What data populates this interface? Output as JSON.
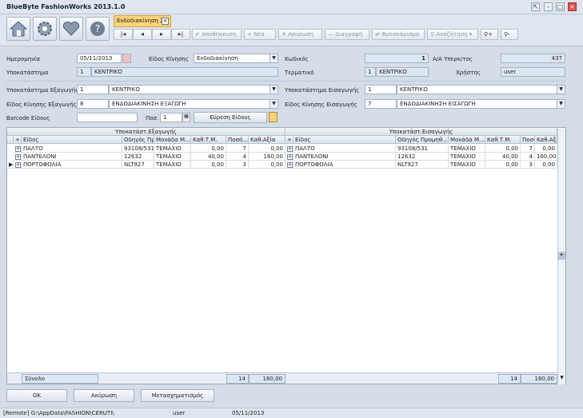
{
  "window": {
    "title": "BlueByte FashionWorks 2013.1.0"
  },
  "tab": {
    "label": "Ενδοδιακίνηση 2"
  },
  "toolbar": {
    "save": "Αποθήκευση",
    "new": "Νέα",
    "cancel": "Ακύρωση",
    "delete": "Διαγραφή",
    "refresh": "Φρεσκάρισμα",
    "search": "Αναζήτηση"
  },
  "form": {
    "date_label": "Ημερομηνία",
    "date_value": "05/11/2013",
    "move_type_label": "Είδος Κίνησης",
    "move_type_value": "Ενδοδιακίνηση",
    "code_label": "Κωδικός",
    "code_value": "1",
    "aa_label": "Α/Α Υπερκ/τος",
    "aa_value": "437",
    "branch_label": "Υποκατάστημα",
    "branch_code": "1",
    "branch_name": "ΚΕΝΤΡΙΚΟ",
    "terminal_label": "Τερματικό",
    "terminal_code": "1",
    "terminal_name": "ΚΕΝΤΡΙΚΟ",
    "user_label": "Χρήστης",
    "user_value": "user",
    "exp_branch_label": "Υποκατάστημα Εξαγωγής",
    "exp_branch_code": "1",
    "exp_branch_name": "ΚΕΝΤΡΙΚΟ",
    "imp_branch_label": "Υποκατάστημα Εισαγωγής",
    "imp_branch_code": "1",
    "imp_branch_name": "ΚΕΝΤΡΙΚΟ",
    "exp_type_label": "Είδος Κίνησης Εξαγωγής",
    "exp_type_code": "8",
    "exp_type_name": "ΕΝΔΟΔΙΑΚΙΝΗΣΗ ΕΞΑΓΩΓΗ",
    "imp_type_label": "Είδος Κίνησης Εισαγωγής",
    "imp_type_code": "7",
    "imp_type_name": "ΕΝΔΟΔΙΑΚΙΝΗΣΗ ΕΙΣΑΓΩΓΗ",
    "barcode_label": "Barcode Είδους",
    "qty_label": "Ποσ.",
    "qty_value": "1",
    "find_button": "Εύρεση Είδους"
  },
  "grid_left": {
    "group": "Υποκατάστ.Εξαγωγής",
    "headers": [
      "Είδος",
      "Οδηγός Προμηθ...",
      "Μονάδα Μ...",
      "Καθ.Τ.Μ.",
      "Ποσό...",
      "Καθ.Αξία"
    ],
    "rows": [
      [
        "ΠΑΛΤΟ",
        "93108/531",
        "ΤΕΜΑΧΙΟ",
        "0,00",
        "7",
        "0,00"
      ],
      [
        "ΠΑΝΤΕΛΟΝΙ",
        "12632",
        "ΤΕΜΑΧΙΟ",
        "40,00",
        "4",
        "160,00"
      ],
      [
        "ΠΟΡΤΟΦΟΛΙΑ",
        "NLT927",
        "ΤΕΜΑΧΙΟ",
        "0,00",
        "3",
        "0,00"
      ]
    ],
    "total_label": "Σύνολο",
    "total_qty": "14",
    "total_value": "160,00"
  },
  "grid_right": {
    "group": "Υποκατάστ.Εισαγωγής",
    "headers": [
      "Είδος",
      "Οδηγός Προμηθ...",
      "Μονάδα Μ...",
      "Καθ.Τ.Μ.",
      "Ποσό...",
      "Καθ.Αξία"
    ],
    "rows": [
      [
        "ΠΑΛΤΟ",
        "93108/531",
        "ΤΕΜΑΧΙΟ",
        "0,00",
        "7",
        "0,00"
      ],
      [
        "ΠΑΝΤΕΛΟΝΙ",
        "12632",
        "ΤΕΜΑΧΙΟ",
        "40,00",
        "4",
        "160,00"
      ],
      [
        "ΠΟΡΤΟΦΟΛΙΑ",
        "NLT927",
        "ΤΕΜΑΧΙΟ",
        "0,00",
        "3",
        "0,00"
      ]
    ],
    "total_qty": "14",
    "total_value": "160,00"
  },
  "footer": {
    "ok": "OK",
    "cancel": "Ακύρωση",
    "transform": "Μετασχηματισμός"
  },
  "status": {
    "path": "[Remote] G:\\AppData\\FASHION\\CERUTI\\",
    "user": "user",
    "date": "05/11/2013"
  },
  "colors": {
    "tab": "#fbd37a",
    "accent": "#d9534f"
  }
}
